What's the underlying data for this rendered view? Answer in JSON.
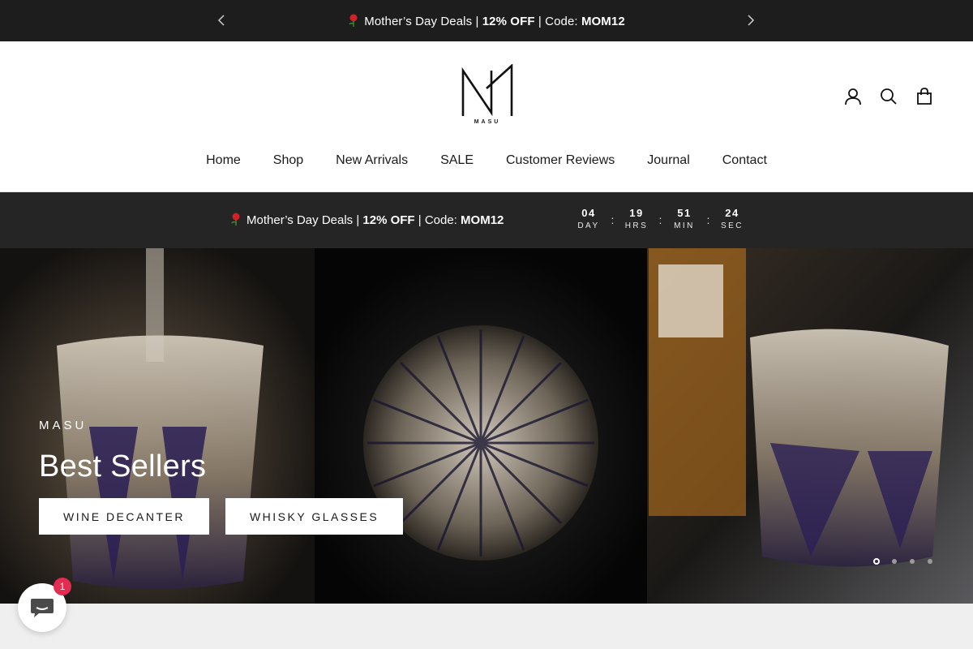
{
  "announcement": {
    "prefix": "Mother’s Day Deals | ",
    "discount": "12% OFF",
    "mid": " | Code: ",
    "code": "MOM12",
    "prev_icon": "chevron-left-icon",
    "next_icon": "chevron-right-icon"
  },
  "brand": {
    "logo_word": "MASU"
  },
  "header_icons": [
    "account-icon",
    "search-icon",
    "cart-icon"
  ],
  "nav": {
    "items": [
      {
        "label": "Home"
      },
      {
        "label": "Shop"
      },
      {
        "label": "New Arrivals"
      },
      {
        "label": "SALE"
      },
      {
        "label": "Customer Reviews"
      },
      {
        "label": "Journal"
      },
      {
        "label": "Contact"
      }
    ]
  },
  "countdown": {
    "prefix": "Mother’s Day Deals | ",
    "discount": "12% OFF",
    "mid": " | Code: ",
    "code": "MOM12",
    "separator": ":",
    "units": [
      {
        "value": "04",
        "label": "DAY"
      },
      {
        "value": "19",
        "label": "HRS"
      },
      {
        "value": "51",
        "label": "MIN"
      },
      {
        "value": "24",
        "label": "SEC"
      }
    ]
  },
  "hero": {
    "subheading": "MASU",
    "title": "Best Sellers",
    "buttons": [
      {
        "label": "WINE DECANTER"
      },
      {
        "label": "WHISKY GLASSES"
      }
    ],
    "slides_total": 4,
    "active_slide": 1
  },
  "chat": {
    "badge": "1",
    "icon": "chat-icon"
  },
  "colors": {
    "announcement_bg": "#1d1d1d",
    "countdown_bg": "#252525",
    "badge": "#e52b50"
  }
}
